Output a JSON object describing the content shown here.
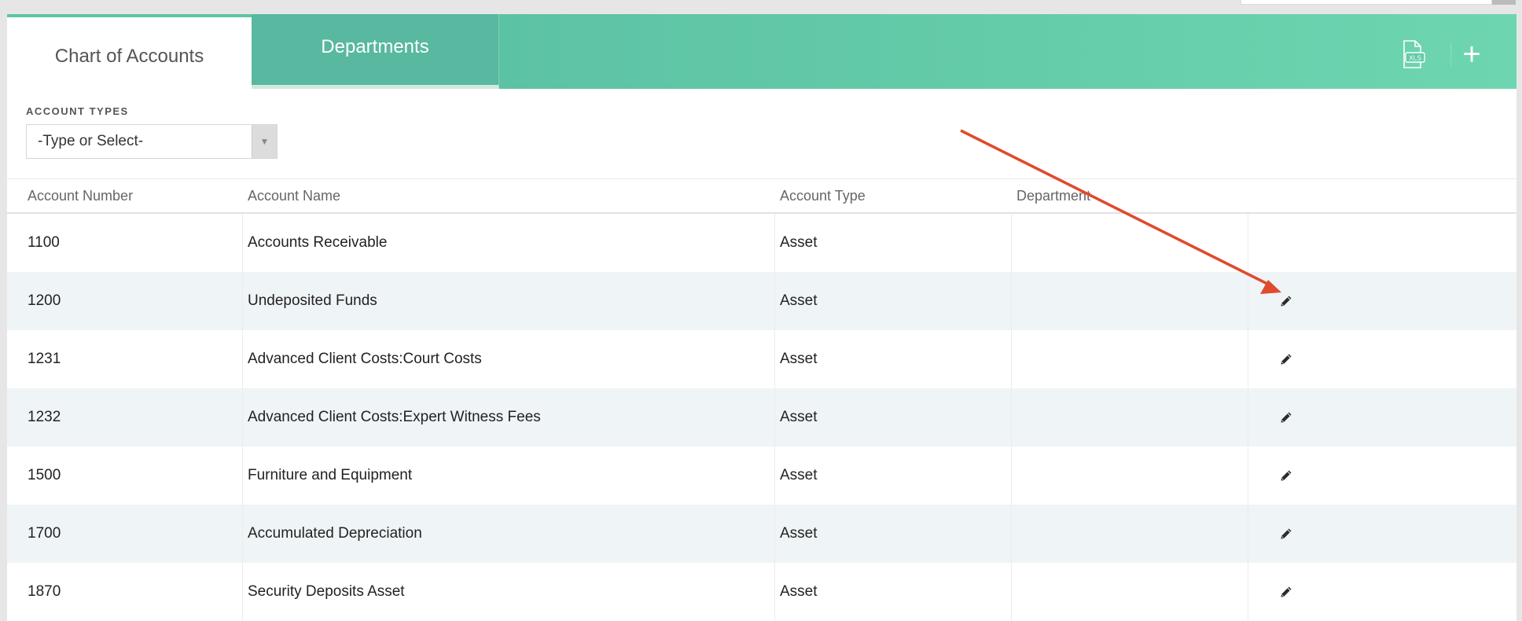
{
  "tabs": [
    {
      "label": "Chart of Accounts",
      "active": true
    },
    {
      "label": "Departments",
      "active": false
    }
  ],
  "toolbar": {
    "xls_icon": "xls-export-icon",
    "add_icon": "plus-icon",
    "add_label": "+",
    "xls_text": "XLS"
  },
  "filter": {
    "label": "ACCOUNT TYPES",
    "placeholder": "-Type or Select-"
  },
  "table": {
    "headers": [
      "Account Number",
      "Account Name",
      "Account Type",
      "Department",
      ""
    ],
    "rows": [
      {
        "number": "1100",
        "name": "Accounts Receivable",
        "type": "Asset",
        "department": "",
        "editable": false
      },
      {
        "number": "1200",
        "name": "Undeposited Funds",
        "type": "Asset",
        "department": "",
        "editable": true
      },
      {
        "number": "1231",
        "name": "Advanced Client Costs:Court Costs",
        "type": "Asset",
        "department": "",
        "editable": true
      },
      {
        "number": "1232",
        "name": "Advanced Client Costs:Expert Witness Fees",
        "type": "Asset",
        "department": "",
        "editable": true
      },
      {
        "number": "1500",
        "name": "Furniture and Equipment",
        "type": "Asset",
        "department": "",
        "editable": true
      },
      {
        "number": "1700",
        "name": "Accumulated Depreciation",
        "type": "Asset",
        "department": "",
        "editable": true
      },
      {
        "number": "1870",
        "name": "Security Deposits Asset",
        "type": "Asset",
        "department": "",
        "editable": true
      }
    ]
  },
  "colors": {
    "accent": "#5cc6a7",
    "annotation": "#e04a2f",
    "row_alt": "#eff4f7"
  }
}
